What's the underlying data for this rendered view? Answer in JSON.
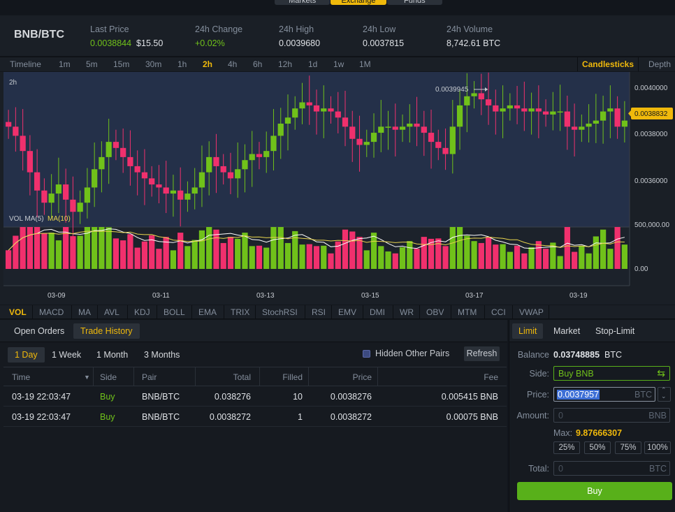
{
  "top_nav": [
    "Markets",
    "Exchange",
    "Funds"
  ],
  "ticker": {
    "pair": "BNB/BTC",
    "last_price_label": "Last Price",
    "last_price": "0.0038844",
    "last_price_usd": "$15.50",
    "change_label": "24h Change",
    "change": "+0.02%",
    "high_label": "24h High",
    "high": "0.0039680",
    "low_label": "24h Low",
    "low": "0.0037815",
    "volume_label": "24h Volume",
    "volume": "8,742.61 BTC"
  },
  "intervals": [
    "Timeline",
    "1m",
    "5m",
    "15m",
    "30m",
    "1h",
    "2h",
    "4h",
    "6h",
    "12h",
    "1d",
    "1w",
    "1M"
  ],
  "active_interval": "2h",
  "chart_tabs": {
    "candlesticks": "Candlesticks",
    "depth": "Depth"
  },
  "chart": {
    "interval_label": "2h",
    "max_marker": "0.0039945",
    "current_price": "0.0038832",
    "price_ticks": [
      "0.0040000",
      "0.0038000",
      "0.0036000"
    ],
    "vol_label": "VOL MA(5)",
    "vol_ma10_label": "MA(10)",
    "vol_ticks": [
      "500,000.00",
      "0.00"
    ],
    "date_ticks": [
      "03-09",
      "03-11",
      "03-13",
      "03-15",
      "03-17",
      "03-19"
    ]
  },
  "chart_data": {
    "type": "candlestick",
    "y_range": [
      0.00353,
      0.00404
    ],
    "up_color": "#70c11a",
    "down_color": "#f0306d",
    "close_points": [
      0.00386,
      0.00383,
      0.00378,
      0.00371,
      0.00365,
      0.00361,
      0.00364,
      0.00367,
      0.00362,
      0.00358,
      0.00361,
      0.00366,
      0.00372,
      0.00376,
      0.00381,
      0.00379,
      0.00376,
      0.00373,
      0.00371,
      0.00369,
      0.00367,
      0.00366,
      0.00364,
      0.00365,
      0.00362,
      0.00364,
      0.00366,
      0.00371,
      0.00376,
      0.00373,
      0.00371,
      0.00369,
      0.00372,
      0.00375,
      0.00377,
      0.00376,
      0.00378,
      0.00383,
      0.00387,
      0.00389,
      0.00392,
      0.00394,
      0.00393,
      0.00391,
      0.00392,
      0.00391,
      0.00389,
      0.00386,
      0.00382,
      0.0038,
      0.00381,
      0.00384,
      0.00386,
      0.00386,
      0.00385,
      0.00386,
      0.00387,
      0.00386,
      0.00384,
      0.00381,
      0.00379,
      0.00377,
      0.00386,
      0.00393,
      0.00396,
      0.00397,
      0.00395,
      0.00393,
      0.00391,
      0.00392,
      0.00393,
      0.00392,
      0.00391,
      0.00392,
      0.00391,
      0.0039,
      0.00391,
      0.00391,
      0.00386,
      0.00385,
      0.00386,
      0.00387,
      0.00388,
      0.00391,
      0.00392,
      0.00386,
      0.00388
    ]
  },
  "indicators": [
    "VOL",
    "MACD",
    "MA",
    "AVL",
    "KDJ",
    "BOLL",
    "EMA",
    "TRIX",
    "StochRSI",
    "RSI",
    "EMV",
    "DMI",
    "WR",
    "OBV",
    "MTM",
    "CCI",
    "VWAP"
  ],
  "orders": {
    "tabs": [
      "Open Orders",
      "Trade History"
    ],
    "ranges": [
      "1 Day",
      "1 Week",
      "1 Month",
      "3 Months"
    ],
    "hidden_pairs": "Hidden Other Pairs",
    "refresh": "Refresh",
    "columns": [
      "Time",
      "Side",
      "Pair",
      "Total",
      "Filled",
      "Price",
      "Fee"
    ],
    "rows": [
      {
        "time": "03-19 22:03:47",
        "side": "Buy",
        "pair": "BNB/BTC",
        "total": "0.038276",
        "filled": "10",
        "price": "0.0038276",
        "fee": "0.005415 BNB"
      },
      {
        "time": "03-19 22:03:47",
        "side": "Buy",
        "pair": "BNB/BTC",
        "total": "0.0038272",
        "filled": "1",
        "price": "0.0038272",
        "fee": "0.00075 BNB"
      }
    ]
  },
  "form": {
    "tabs": [
      "Limit",
      "Market",
      "Stop-Limit"
    ],
    "balance_label": "Balance",
    "balance": "0.03748885",
    "balance_unit": "BTC",
    "side_label": "Side:",
    "side_value": "Buy BNB",
    "price_label": "Price:",
    "price_value": "0.0037957",
    "price_unit": "BTC",
    "amount_label": "Amount:",
    "amount_placeholder": "0",
    "amount_unit": "BNB",
    "max_label": "Max:",
    "max_value": "9.87666307",
    "percents": [
      "25%",
      "50%",
      "75%",
      "100%"
    ],
    "total_label": "Total:",
    "total_placeholder": "0",
    "total_unit": "BTC",
    "buy_label": "Buy"
  }
}
